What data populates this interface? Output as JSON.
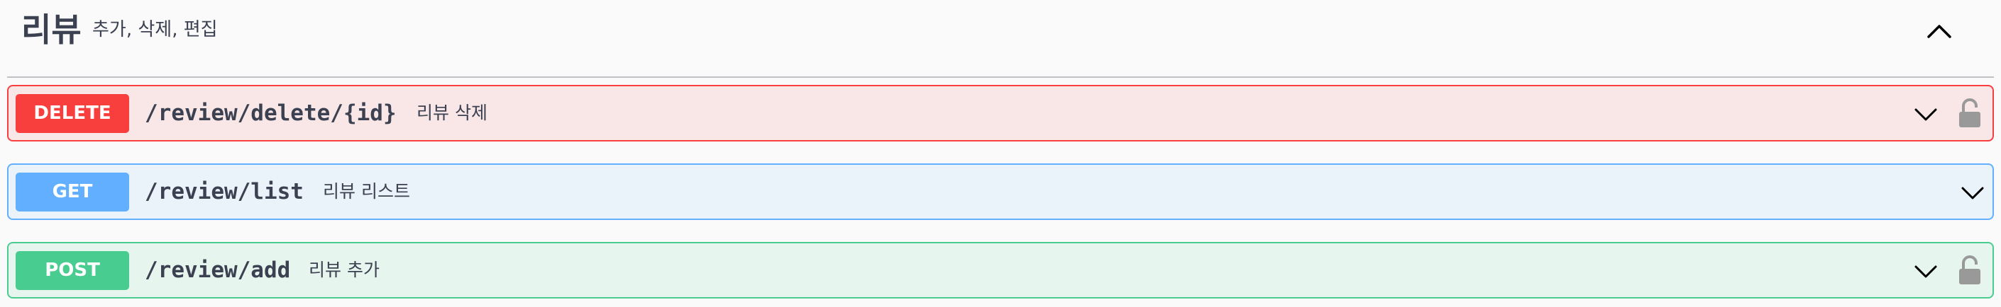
{
  "tag": {
    "title": "리뷰",
    "description": "추가, 삭제, 편집"
  },
  "operations": [
    {
      "method": "DELETE",
      "path": "/review/delete/{id}",
      "summary": "리뷰 삭제",
      "locked": true,
      "color": "#f93e3e"
    },
    {
      "method": "GET",
      "path": "/review/list",
      "summary": "리뷰 리스트",
      "locked": false,
      "color": "#61affe"
    },
    {
      "method": "POST",
      "path": "/review/add",
      "summary": "리뷰 추가",
      "locked": true,
      "color": "#49cc90"
    }
  ],
  "icons": {
    "collapse": "chevron-up-icon",
    "expand": "chevron-down-icon",
    "auth": "lock-icon"
  }
}
